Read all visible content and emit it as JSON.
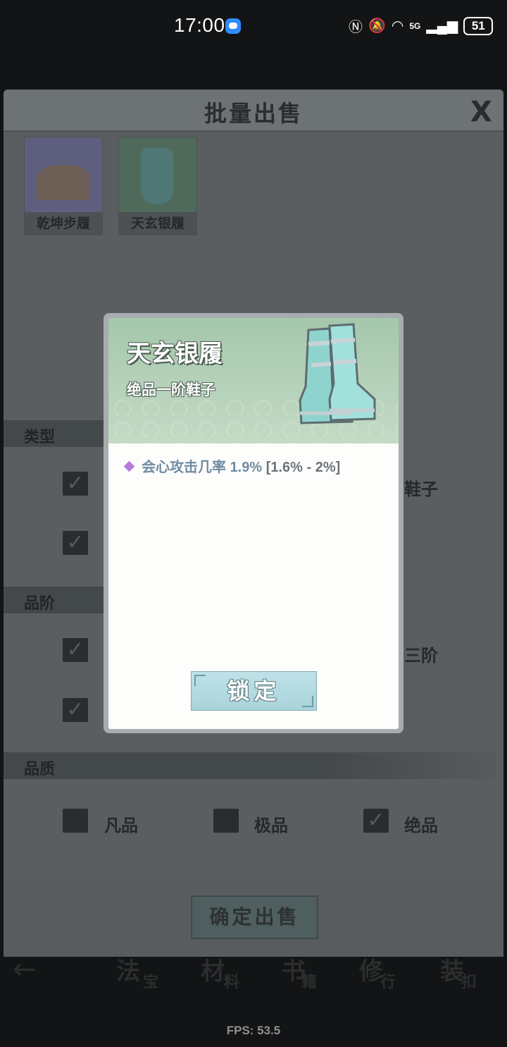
{
  "status_bar": {
    "time": "17:00",
    "network": "5G",
    "battery": "51"
  },
  "panel": {
    "title": "批量出售",
    "close_label": "X",
    "items": [
      {
        "name": "乾坤步履",
        "art_color": "#6c6b8f"
      },
      {
        "name": "天玄银履",
        "art_color": "#5b7b6a"
      }
    ],
    "sections": {
      "type": {
        "label": "类型",
        "right_option": "鞋子"
      },
      "grade": {
        "label": "品阶",
        "right_option": "三阶"
      },
      "quality": {
        "label": "品质",
        "options": [
          {
            "label": "凡品",
            "checked": false
          },
          {
            "label": "极品",
            "checked": false
          },
          {
            "label": "绝品",
            "checked": true
          }
        ]
      }
    },
    "confirm_sell_label": "确定出售"
  },
  "background_nav": {
    "items": [
      "法",
      "材",
      "书",
      "修",
      "装"
    ],
    "subs": [
      "宝",
      "料",
      "籍",
      "行",
      "扣"
    ]
  },
  "fps_label": "FPS: 53.5",
  "popup": {
    "title": "天玄银履",
    "subtitle": "绝品一阶鞋子",
    "stats": [
      {
        "name": "会心攻击几率",
        "value": "1.9%",
        "range": "[1.6% - 2%]"
      }
    ],
    "lock_label": "锁定"
  },
  "colors": {
    "header_green": "#a4c7ab",
    "stat_blue": "#6f8ca2",
    "diamond_purple": "#b57bd9",
    "lock_button": "#bfe2e8"
  }
}
